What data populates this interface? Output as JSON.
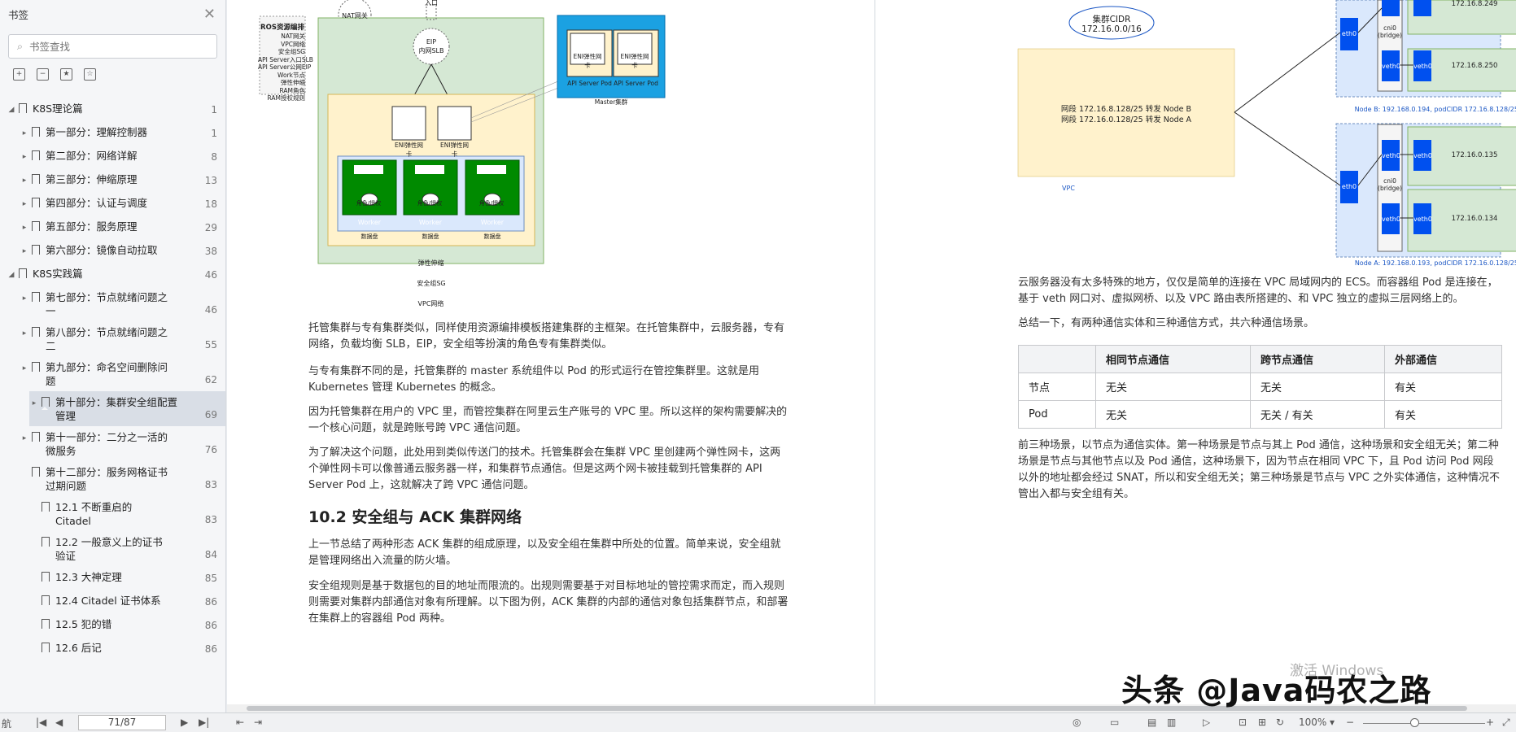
{
  "sidebar": {
    "title": "书签",
    "search_placeholder": "书签查找",
    "items": [
      {
        "label": "K8S理论篇",
        "page": "1",
        "level": 0,
        "arrow": "◢"
      },
      {
        "label": "第一部分：理解控制器",
        "page": "1",
        "level": 1,
        "arrow": "▸"
      },
      {
        "label": "第二部分：网络详解",
        "page": "8",
        "level": 1,
        "arrow": "▸"
      },
      {
        "label": "第三部分：伸缩原理",
        "page": "13",
        "level": 1,
        "arrow": "▸"
      },
      {
        "label": "第四部分：认证与调度",
        "page": "18",
        "level": 1,
        "arrow": "▸"
      },
      {
        "label": "第五部分：服务原理",
        "page": "29",
        "level": 1,
        "arrow": "▸"
      },
      {
        "label": "第六部分：镜像自动拉取",
        "page": "38",
        "level": 1,
        "arrow": "▸"
      },
      {
        "label": "K8S实践篇",
        "page": "46",
        "level": 0,
        "arrow": "◢"
      },
      {
        "label": "第七部分：节点就绪问题之一",
        "page": "46",
        "level": 1,
        "arrow": "▸"
      },
      {
        "label": "第八部分：节点就绪问题之二",
        "page": "55",
        "level": 1,
        "arrow": "▸"
      },
      {
        "label": "第九部分：命名空间删除问题",
        "page": "62",
        "level": 1,
        "arrow": "▸"
      },
      {
        "label": "第十部分：集群安全组配置管理",
        "page": "69",
        "level": 1,
        "arrow": "▸",
        "active": true
      },
      {
        "label": "第十一部分：二分之一活的微服务",
        "page": "76",
        "level": 1,
        "arrow": "▸"
      },
      {
        "label": "第十二部分：服务网格证书过期问题",
        "page": "83",
        "level": 1,
        "arrow": ""
      },
      {
        "label": "12.1 不断重启的 Citadel",
        "page": "83",
        "level": 2,
        "arrow": ""
      },
      {
        "label": "12.2 一般意义上的证书验证",
        "page": "84",
        "level": 2,
        "arrow": ""
      },
      {
        "label": "12.3 大神定理",
        "page": "85",
        "level": 2,
        "arrow": ""
      },
      {
        "label": "12.4 Citadel 证书体系",
        "page": "86",
        "level": 2,
        "arrow": ""
      },
      {
        "label": "12.5 犯的错",
        "page": "86",
        "level": 2,
        "arrow": ""
      },
      {
        "label": "12.6 后记",
        "page": "86",
        "level": 2,
        "arrow": ""
      }
    ]
  },
  "left_page": {
    "diagram": {
      "ros_title": "ROS资源编排",
      "ros_items": "NAT网关\nVPC网络\n安全组SG\nAPI Server入口SLB\nAPI Server公网EIP\nWork节点\n弹性伸缩\nRAM角色\nRAM授权规则",
      "nat": "NAT网关",
      "entry": "入口",
      "eip": "EIP\n内网SLB",
      "eni": "ENI弹性网卡",
      "master_eni": "ENI弹性网卡",
      "api_pod": "API Server Pod",
      "master_cluster": "Master集群",
      "role": "角色/授权",
      "worker": "Worker",
      "disk": "数据盘",
      "scaling": "弹性伸缩",
      "sg": "安全组SG",
      "vpc": "VPC网络"
    },
    "paragraphs": [
      "托管集群与专有集群类似，同样使用资源编排模板搭建集群的主框架。在托管集群中，云服务器，专有网络，负载均衡 SLB，EIP，安全组等扮演的角色专有集群类似。",
      "与专有集群不同的是，托管集群的 master 系统组件以 Pod 的形式运行在管控集群里。这就是用 Kubernetes 管理 Kubernetes 的概念。",
      "因为托管集群在用户的 VPC 里，而管控集群在阿里云生产账号的 VPC 里。所以这样的架构需要解决的一个核心问题，就是跨账号跨 VPC 通信问题。",
      "为了解决这个问题，此处用到类似传送门的技术。托管集群会在集群 VPC 里创建两个弹性网卡，这两个弹性网卡可以像普通云服务器一样，和集群节点通信。但是这两个网卡被挂载到托管集群的 API Server Pod 上，这就解决了跨 VPC 通信问题。"
    ],
    "heading": "10.2 安全组与 ACK 集群网络",
    "paragraphs2": [
      "上一节总结了两种形态 ACK 集群的组成原理，以及安全组在集群中所处的位置。简单来说，安全组就是管理网络出入流量的防火墙。",
      "安全组规则是基于数据包的目的地址而限流的。出规则需要基于对目标地址的管控需求而定，而入规则则需要对集群内部通信对象有所理解。以下图为例，ACK 集群的内部的通信对象包括集群节点，和部署在集群上的容器组 Pod 两种。"
    ]
  },
  "right_page": {
    "diagram": {
      "cidr_title": "集群CIDR",
      "cidr_value": "172.16.0.0/16",
      "route1": "网段 172.16.8.128/25 转发 Node B",
      "route2": "网段 172.16.0.128/25 转发 Node A",
      "vpc": "VPC",
      "eth0": "eth0",
      "veth0": "veth0",
      "cni0": "cni0\n(bridge)",
      "ip_b1": "172.16.8.249",
      "ip_b2": "172.16.8.250",
      "ip_a1": "172.16.0.135",
      "ip_a2": "172.16.0.134",
      "node_b": "Node B: 192.168.0.194, podCIDR 172.16.8.128/25",
      "node_a": "Node A: 192.168.0.193, podCIDR 172.16.0.128/25"
    },
    "paragraph1": "云服务器没有太多特殊的地方，仅仅是简单的连接在 VPC 局域网内的 ECS。而容器组 Pod 是连接在，基于 veth 网口对、虚拟网桥、以及 VPC 路由表所搭建的、和 VPC 独立的虚拟三层网络上的。",
    "paragraph2": "总结一下，有两种通信实体和三种通信方式，共六种通信场景。",
    "table": {
      "headers": [
        "",
        "相同节点通信",
        "跨节点通信",
        "外部通信"
      ],
      "rows": [
        [
          "节点",
          "无关",
          "无关",
          "有关"
        ],
        [
          "Pod",
          "无关",
          "无关 / 有关",
          "有关"
        ]
      ]
    },
    "paragraph3": "前三种场景，以节点为通信实体。第一种场景是节点与其上 Pod 通信，这种场景和安全组无关；第二种场景是节点与其他节点以及 Pod 通信，这种场景下，因为节点在相同 VPC 下，且 Pod 访问 Pod 网段以外的地址都会经过 SNAT，所以和安全组无关；第三种场景是节点与 VPC 之外实体通信，这种情况不管出入都与安全组有关。"
  },
  "statusbar": {
    "nav": "航",
    "page_indicator": "71/87",
    "zoom": "100%"
  },
  "overlay": {
    "watermark": "头条 @Java码农之路",
    "activate": "激活 Windows"
  },
  "colors": {
    "green_panel": "#d5e8d4",
    "yellow_panel": "#fff2cc",
    "blue_panel": "#dae8fc",
    "master_blue": "#1ba1e2",
    "eth_blue": "#0050ef",
    "dark_green": "#008a00"
  }
}
